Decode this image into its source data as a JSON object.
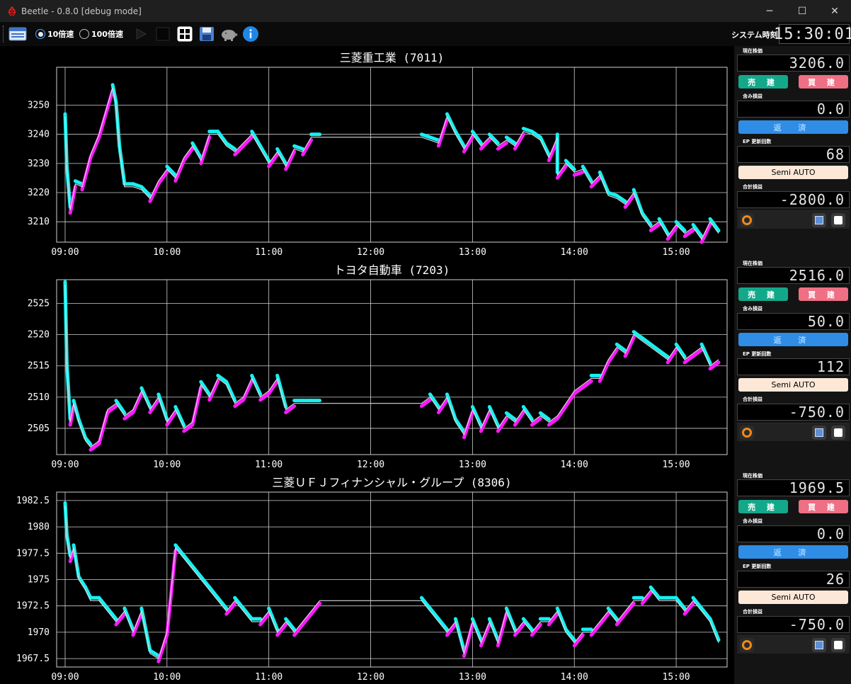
{
  "window": {
    "title": "Beetle - 0.8.0 [debug mode]",
    "minimize": "─",
    "maximize": "☐",
    "close": "✕"
  },
  "toolbar": {
    "speed_10_label": "10倍速",
    "speed_100_label": "100倍速",
    "selected_speed": "10倍速",
    "play_icon": "play-icon",
    "stop_icon": "stop-icon",
    "grid_icon": "grid-icon",
    "save_icon": "save-icon",
    "pig_icon": "piggy-bank-icon",
    "info_icon": "info-icon",
    "clock_label": "システム時刻",
    "clock_value": "15:30:01"
  },
  "panels": [
    {
      "price_label": "現在株価",
      "price": "3206.0",
      "sell_label": "売 建",
      "buy_label": "買 建",
      "unrealized_label": "含み損益",
      "unrealized": "0.0",
      "repay_label": "返 済",
      "ep_label": "EP 更新回数",
      "ep_count": "68",
      "mode_label": "Semi AUTO",
      "total_label": "合計損益",
      "total": "-2800.0"
    },
    {
      "price_label": "現在株価",
      "price": "2516.0",
      "sell_label": "売 建",
      "buy_label": "買 建",
      "unrealized_label": "含み損益",
      "unrealized": "50.0",
      "repay_label": "返 済",
      "ep_label": "EP 更新回数",
      "ep_count": "112",
      "mode_label": "Semi AUTO",
      "total_label": "合計損益",
      "total": "-750.0"
    },
    {
      "price_label": "現在株価",
      "price": "1969.5",
      "sell_label": "売 建",
      "buy_label": "買 建",
      "unrealized_label": "含み損益",
      "unrealized": "0.0",
      "repay_label": "返 済",
      "ep_label": "EP 更新回数",
      "ep_count": "26",
      "mode_label": "Semi AUTO",
      "total_label": "合計損益",
      "total": "-750.0"
    }
  ],
  "colors": {
    "bg": "#000000",
    "grid": "#d0d0d0",
    "price_line": "#d8d8d8",
    "trend_up": "#ff17ff",
    "trend_down": "#17f0f0",
    "sell_button": "#14a88a",
    "buy_button": "#ef6f84",
    "repay_button": "#2f8de6",
    "auto_button": "#fde8d8"
  },
  "chart_data": [
    {
      "type": "line",
      "title": "三菱重工業 (7011)",
      "xticks": [
        "09:00",
        "10:00",
        "11:00",
        "12:00",
        "13:00",
        "14:00",
        "15:00"
      ],
      "yticks": [
        3210,
        3220,
        3230,
        3240,
        3250
      ],
      "ylim": [
        3203,
        3263
      ],
      "xlim": [
        "08:55",
        "15:30"
      ],
      "grid": true,
      "series": [
        {
          "role": "price",
          "x": [
            "09:00",
            "09:01",
            "09:03",
            "09:06",
            "09:10",
            "09:15",
            "09:20",
            "09:25",
            "09:28",
            "09:30",
            "09:32",
            "09:35",
            "09:40",
            "09:45",
            "09:50",
            "09:55",
            "10:00",
            "10:05",
            "10:10",
            "10:15",
            "10:20",
            "10:25",
            "10:30",
            "10:35",
            "10:40",
            "10:45",
            "10:50",
            "10:55",
            "11:00",
            "11:05",
            "11:10",
            "11:15",
            "11:20",
            "11:25",
            "11:30",
            "13:50",
            "12:30",
            "12:35",
            "12:40",
            "12:45",
            "12:50",
            "12:55",
            "13:00",
            "13:05",
            "13:10",
            "13:15",
            "13:20",
            "13:25",
            "13:30",
            "13:35",
            "13:40",
            "13:45",
            "13:50",
            "13:55",
            "14:00",
            "14:05",
            "14:10",
            "14:15",
            "14:20",
            "14:25",
            "14:30",
            "14:35",
            "14:40",
            "14:45",
            "14:50",
            "14:55",
            "15:00",
            "15:05",
            "15:10",
            "15:15",
            "15:20",
            "15:25"
          ],
          "y": [
            3246,
            3228,
            3214,
            3223,
            3222,
            3233,
            3240,
            3250,
            3256,
            3250,
            3235,
            3222,
            3222,
            3221,
            3218,
            3224,
            3228,
            3225,
            3232,
            3236,
            3231,
            3240,
            3240,
            3236,
            3234,
            3237,
            3240,
            3235,
            3230,
            3234,
            3229,
            3235,
            3234,
            3239,
            3239,
            3239,
            3239,
            3238,
            3237,
            3246,
            3240,
            3235,
            3240,
            3236,
            3239,
            3236,
            3238,
            3236,
            3241,
            3240,
            3238,
            3232,
            3226,
            3230,
            3227,
            3228,
            3223,
            3226,
            3219,
            3218,
            3216,
            3220,
            3212,
            3208,
            3210,
            3205,
            3209,
            3206,
            3208,
            3204,
            3210,
            3206
          ]
        }
      ]
    },
    {
      "type": "line",
      "title": "トヨタ自動車 (7203)",
      "xticks": [
        "09:00",
        "10:00",
        "11:00",
        "12:00",
        "13:00",
        "14:00",
        "15:00"
      ],
      "yticks": [
        2505,
        2510,
        2515,
        2520,
        2525
      ],
      "ylim": [
        2500.8,
        2528.8
      ],
      "xlim": [
        "08:55",
        "15:30"
      ],
      "grid": true,
      "series": [
        {
          "role": "price",
          "x": [
            "09:00",
            "09:01",
            "09:03",
            "09:05",
            "09:08",
            "09:12",
            "09:15",
            "09:20",
            "09:25",
            "09:30",
            "09:35",
            "09:40",
            "09:45",
            "09:50",
            "09:55",
            "10:00",
            "10:05",
            "10:10",
            "10:15",
            "10:20",
            "10:25",
            "10:30",
            "10:35",
            "10:40",
            "10:45",
            "10:50",
            "10:55",
            "11:00",
            "11:05",
            "11:10",
            "11:15",
            "11:20",
            "11:25",
            "11:30",
            "12:30",
            "12:35",
            "12:40",
            "12:45",
            "12:50",
            "12:55",
            "13:00",
            "13:05",
            "13:10",
            "13:15",
            "13:20",
            "13:25",
            "13:30",
            "13:35",
            "13:40",
            "13:45",
            "13:50",
            "13:55",
            "14:00",
            "14:05",
            "14:10",
            "14:15",
            "14:20",
            "14:25",
            "14:30",
            "14:35",
            "14:40",
            "14:45",
            "14:50",
            "14:55",
            "15:00",
            "15:05",
            "15:10",
            "15:15",
            "15:20",
            "15:25"
          ],
          "y": [
            2528,
            2515,
            2506,
            2509,
            2506,
            2503,
            2502,
            2503,
            2508,
            2509,
            2507,
            2508,
            2511,
            2508,
            2510,
            2506,
            2508,
            2505,
            2506,
            2512,
            2510,
            2513,
            2512,
            2509,
            2510,
            2513,
            2510,
            2511,
            2513,
            2508,
            2509,
            2509,
            2509,
            2509,
            2509,
            2510,
            2508,
            2510,
            2506,
            2504,
            2508,
            2505,
            2508,
            2505,
            2507,
            2506,
            2508,
            2506,
            2507,
            2506,
            2507,
            2509,
            2511,
            2512,
            2513,
            2513,
            2516,
            2518,
            2517,
            2520,
            2519,
            2518,
            2517,
            2516,
            2518,
            2516,
            2517,
            2518,
            2515,
            2516
          ]
        }
      ]
    },
    {
      "type": "line",
      "title": "三菱ＵＦＪフィナンシャル・グループ (8306)",
      "xticks": [
        "09:00",
        "10:00",
        "11:00",
        "12:00",
        "13:00",
        "14:00",
        "15:00"
      ],
      "yticks": [
        1967.5,
        1970.0,
        1972.5,
        1975.0,
        1977.5,
        1980.0,
        1982.5
      ],
      "ylim": [
        1966.7,
        1983.3
      ],
      "xlim": [
        "08:55",
        "15:30"
      ],
      "grid": true,
      "series": [
        {
          "role": "price",
          "x": [
            "09:00",
            "09:01",
            "09:03",
            "09:05",
            "09:08",
            "09:12",
            "09:15",
            "09:20",
            "09:25",
            "09:30",
            "09:35",
            "09:40",
            "09:45",
            "09:50",
            "09:55",
            "10:00",
            "10:05",
            "10:10",
            "10:15",
            "10:20",
            "10:25",
            "10:30",
            "10:35",
            "10:40",
            "10:45",
            "10:50",
            "10:55",
            "11:00",
            "11:05",
            "11:10",
            "11:15",
            "11:20",
            "11:25",
            "11:30",
            "12:30",
            "12:35",
            "12:40",
            "12:45",
            "12:50",
            "12:55",
            "13:00",
            "13:05",
            "13:10",
            "13:15",
            "13:20",
            "13:25",
            "13:30",
            "13:35",
            "13:40",
            "13:45",
            "13:50",
            "13:55",
            "14:00",
            "14:05",
            "14:10",
            "14:15",
            "14:20",
            "14:25",
            "14:30",
            "14:35",
            "14:40",
            "14:45",
            "14:50",
            "14:55",
            "15:00",
            "15:05",
            "15:10",
            "15:15",
            "15:20",
            "15:25"
          ],
          "y": [
            1982,
            1979,
            1977,
            1978,
            1975,
            1974,
            1973,
            1973,
            1972,
            1971,
            1972,
            1970,
            1972,
            1968,
            1967.5,
            1970,
            1978,
            1977,
            1976,
            1975,
            1974,
            1973,
            1972,
            1973,
            1972,
            1971,
            1971,
            1972,
            1970,
            1971,
            1970,
            1971,
            1972,
            1973,
            1973,
            1972,
            1971,
            1970,
            1971,
            1968,
            1971,
            1969,
            1971,
            1969,
            1972,
            1970,
            1971,
            1970,
            1971,
            1971,
            1972,
            1970,
            1969,
            1970,
            1970,
            1971,
            1972,
            1971,
            1972,
            1973,
            1973,
            1974,
            1973,
            1973,
            1973,
            1972,
            1973,
            1972,
            1971,
            1969
          ]
        }
      ]
    }
  ]
}
